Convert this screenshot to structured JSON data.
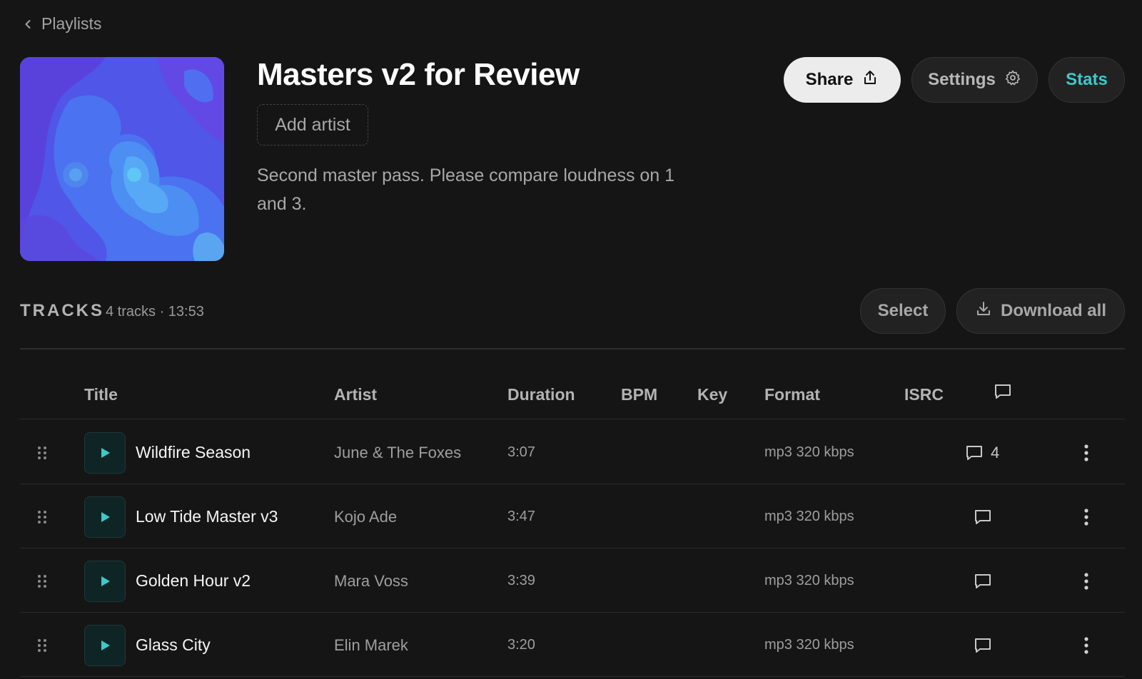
{
  "breadcrumb": {
    "label": "Playlists",
    "icon": "chevron-left-icon"
  },
  "playlist": {
    "title": "Masters v2 for Review",
    "add_artist_label": "Add artist",
    "description": "Second master pass. Please compare loudness on 1 and 3."
  },
  "actions": {
    "share_label": "Share",
    "share_icon": "share-upload-icon",
    "settings_label": "Settings",
    "settings_icon": "gear-icon",
    "stats_label": "Stats",
    "stats_color": "#3ec9c9"
  },
  "tracks_section": {
    "label": "TRACKS",
    "meta": "4 tracks · 13:53",
    "select_label": "Select",
    "download_all_label": "Download all",
    "download_icon": "download-icon"
  },
  "table": {
    "columns": {
      "title": "Title",
      "artist": "Artist",
      "duration": "Duration",
      "bpm": "BPM",
      "key": "Key",
      "format": "Format",
      "isrc": "ISRC",
      "comments_icon": "comment-icon"
    },
    "rows": [
      {
        "title": "Wildfire Season",
        "artist": "June & The Foxes",
        "duration": "3:07",
        "format": "mp3 320 kbps",
        "comments": "4"
      },
      {
        "title": "Low Tide Master v3",
        "artist": "Kojo Ade",
        "duration": "3:47",
        "format": "mp3 320 kbps",
        "comments": ""
      },
      {
        "title": "Golden Hour v2",
        "artist": "Mara Voss",
        "duration": "3:39",
        "format": "mp3 320 kbps",
        "comments": ""
      },
      {
        "title": "Glass City",
        "artist": "Elin Marek",
        "duration": "3:20",
        "format": "mp3 320 kbps",
        "comments": ""
      }
    ]
  },
  "colors": {
    "background": "#151515",
    "accent": "#3ec9c9",
    "play_bg": "#0f2424"
  }
}
